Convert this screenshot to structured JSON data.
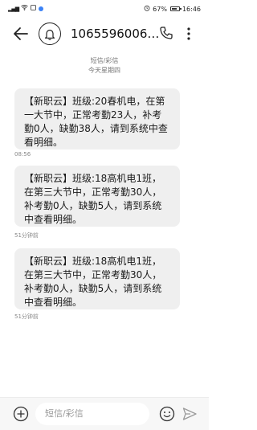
{
  "status_bar": {
    "signal_text": "⁴ᴳll",
    "battery_percent": "67%",
    "time": "16:46"
  },
  "header": {
    "contact": "1065596006…"
  },
  "conversation": {
    "label": "短信/彩信",
    "day": "今天星期四"
  },
  "messages": [
    {
      "text": "【新职云】班级:20春机电，在第一大节中，正常考勤23人，补考勤0人，缺勤38人，请到系统中查看明细。",
      "time": "08:56"
    },
    {
      "text": "【新职云】班级:18高机电1班，在第三大节中，正常考勤30人，补考勤0人，缺勤5人，请到系统中查看明细。",
      "time": "51分钟前"
    },
    {
      "text": "【新职云】班级:18高机电1班，在第三大节中，正常考勤30人，补考勤0人，缺勤5人，请到系统中查看明细。",
      "time": "51分钟前"
    }
  ],
  "composer": {
    "placeholder": "短信/彩信"
  }
}
